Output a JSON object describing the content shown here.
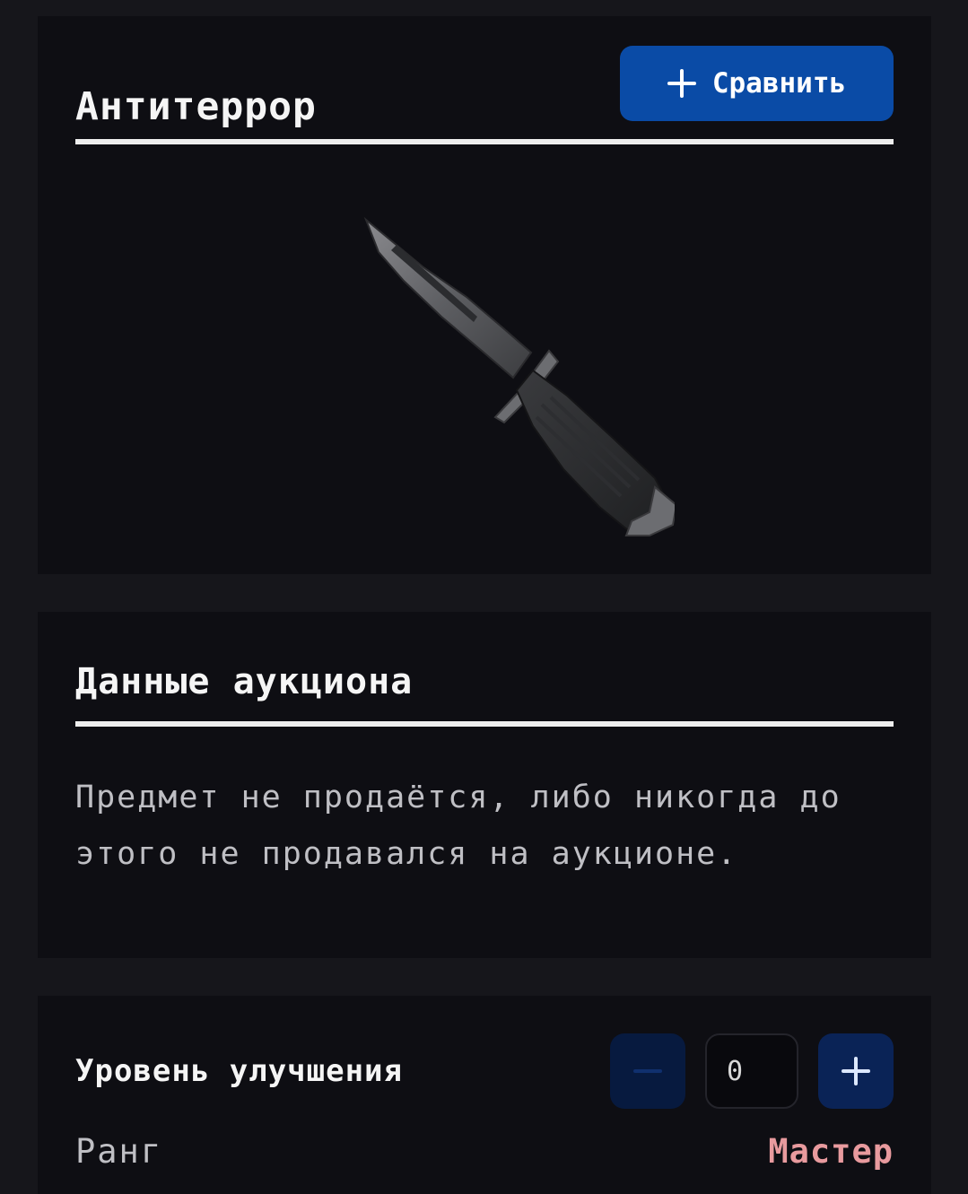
{
  "item": {
    "title": "Антитеррор",
    "compare_label": "Сравнить",
    "image_icon": "combat-knife-icon"
  },
  "auction": {
    "title": "Данные аукциона",
    "message": "Предмет не продаётся, либо никогда до этого не продавался на аукционе."
  },
  "upgrade": {
    "label": "Уровень улучшения",
    "value": "0",
    "decrement_icon": "minus-icon",
    "increment_icon": "plus-icon"
  },
  "rank": {
    "label": "Ранг",
    "value": "Мастер"
  },
  "colors": {
    "page_bg": "#16161b",
    "card_bg": "#0e0e13",
    "accent_blue": "#0a4ba6",
    "rank_color": "#e89a9e"
  }
}
